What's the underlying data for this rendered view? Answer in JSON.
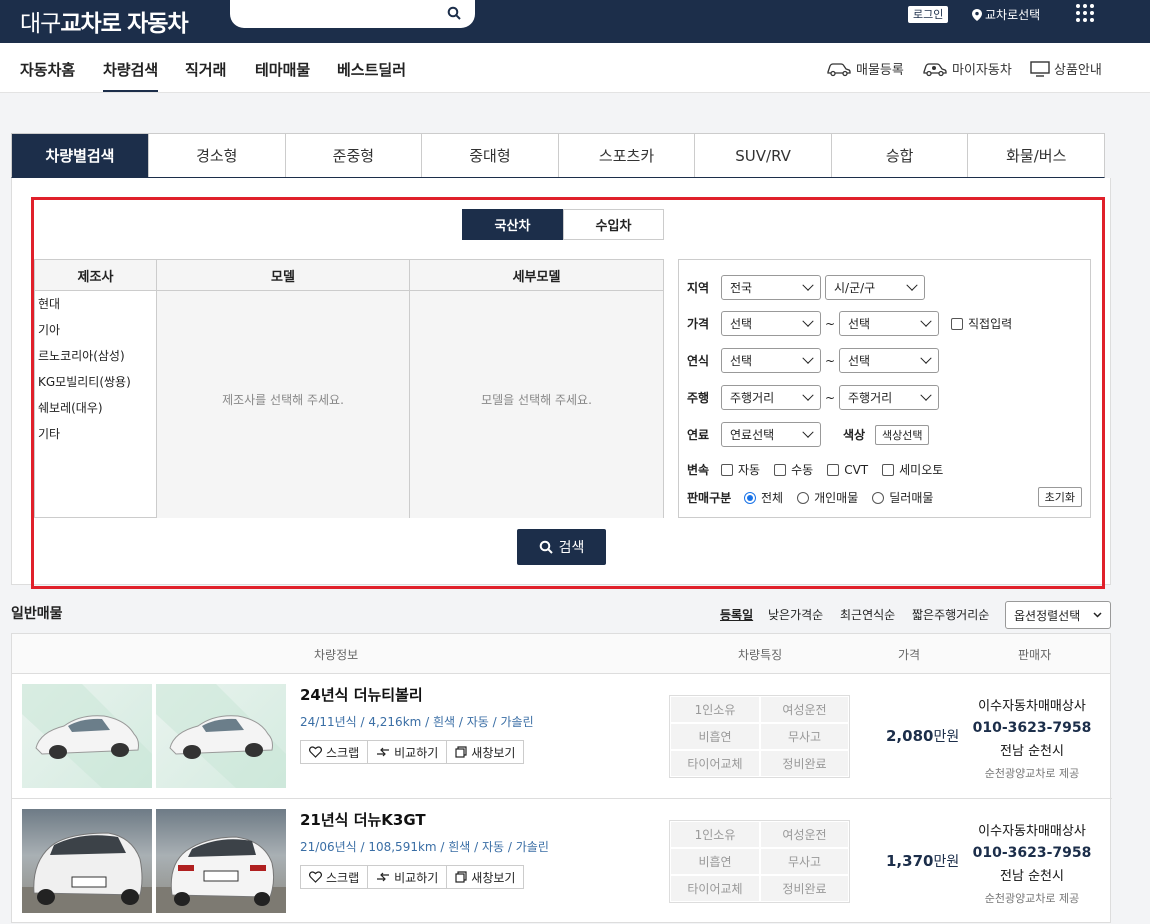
{
  "header": {
    "logo_light": "대구",
    "logo_bold": "교차로",
    "logo_rest": "자동차",
    "search_placeholder": "",
    "login": "로그인",
    "region": "교차로선택"
  },
  "nav": {
    "items": [
      "자동차홈",
      "차량검색",
      "직거래",
      "테마매물",
      "베스트딜러"
    ],
    "active": "차량검색",
    "util": [
      "매물등록",
      "마이자동차",
      "상품안내"
    ]
  },
  "category_tabs": [
    "차량별검색",
    "경소형",
    "준중형",
    "중대형",
    "스포츠카",
    "SUV/RV",
    "승합",
    "화물/버스"
  ],
  "origin_tabs": [
    "국산차",
    "수입차"
  ],
  "maker_table": {
    "headers": [
      "제조사",
      "모델",
      "세부모델"
    ],
    "makers": [
      "현대",
      "기아",
      "르노코리아(삼성)",
      "KG모빌리티(쌍용)",
      "쉐보레(대우)",
      "기타"
    ],
    "model_placeholder": "제조사를 선택해 주세요.",
    "detail_placeholder": "모델을 선택해 주세요."
  },
  "filters": {
    "region_label": "지역",
    "region_value": "전국",
    "district_value": "시/군/구",
    "price_label": "가격",
    "price_from": "선택",
    "price_to": "선택",
    "direct_input": "직접입력",
    "year_label": "연식",
    "year_from": "선택",
    "year_to": "선택",
    "mileage_label": "주행",
    "mileage_from": "주행거리",
    "mileage_to": "주행거리",
    "fuel_label": "연료",
    "fuel_value": "연료선택",
    "color_label": "색상",
    "color_btn": "색상선택",
    "trans_label": "변속",
    "trans_options": [
      "자동",
      "수동",
      "CVT",
      "세미오토"
    ],
    "sale_label": "판매구분",
    "sale_options": [
      "전체",
      "개인매물",
      "딜러매물"
    ],
    "reset": "초기화",
    "tilde": "~"
  },
  "search_button": "검색",
  "listing": {
    "title": "일반매물",
    "sort_options": [
      "등록일",
      "낮은가격순",
      "최근연식순",
      "짧은주행거리순"
    ],
    "sort_select": "옵션정렬선택",
    "columns": [
      "차량정보",
      "차량특징",
      "가격",
      "판매자"
    ],
    "actions": [
      "스크랩",
      "비교하기",
      "새창보기"
    ],
    "features": [
      "1인소유",
      "여성운전",
      "비흡연",
      "무사고",
      "타이어교체",
      "정비완료"
    ],
    "rows": [
      {
        "title": "24년식 더뉴티볼리",
        "spec": "24/11년식 / 4,216km / 흰색 / 자동 / 가솔린",
        "price_num": "2,080",
        "price_unit": "만원",
        "seller_name": "이수자동차매매상사",
        "seller_phone": "010-3623-7958",
        "seller_area": "전남 순천시",
        "seller_source": "순천광양교차로 제공"
      },
      {
        "title": "21년식 더뉴K3GT",
        "spec": "21/06년식 / 108,591km / 흰색 / 자동 / 가솔린",
        "price_num": "1,370",
        "price_unit": "만원",
        "seller_name": "이수자동차매매상사",
        "seller_phone": "010-3623-7958",
        "seller_area": "전남 순천시",
        "seller_source": "순천광양교차로 제공"
      }
    ]
  },
  "colors": {
    "navy": "#1c2e4a",
    "red_frame": "#e0202a",
    "link_blue": "#3a6ea5"
  }
}
